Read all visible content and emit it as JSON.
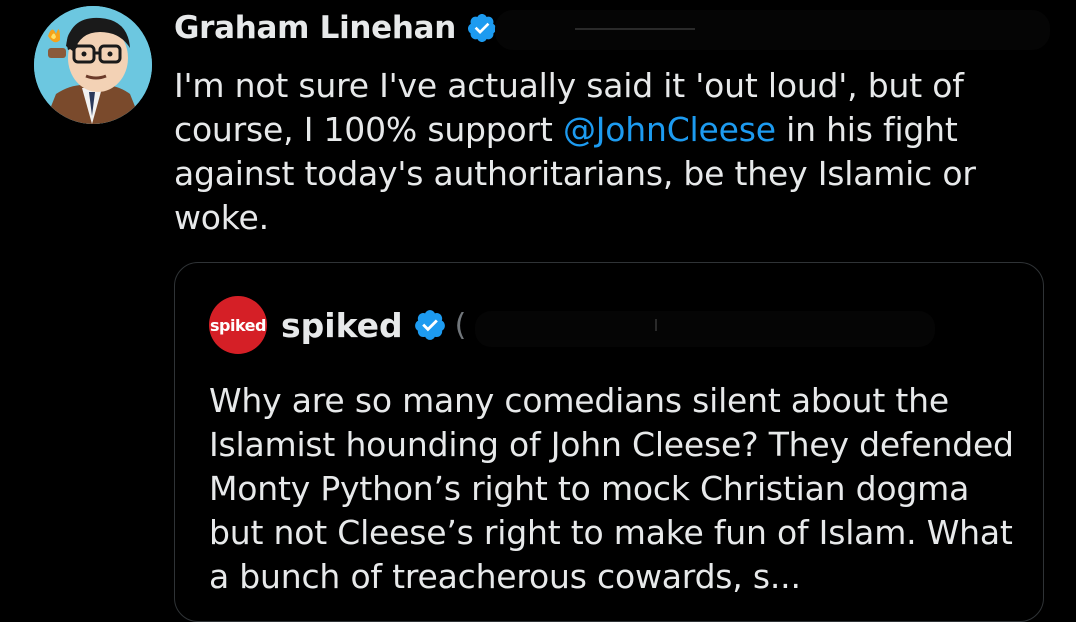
{
  "tweet": {
    "author_name": "Graham Linehan",
    "text_before": "I'm not sure I've actually said it 'out loud', but of course, I 100% support ",
    "mention": "@JohnCleese",
    "text_after": " in his fight against today's authoritarians, be they Islamic or woke."
  },
  "quote": {
    "avatar_text": "spiked",
    "author_name": "spiked",
    "handle_prefix": "(",
    "text": "Why are so many comedians silent about the Islamist hounding of John Cleese? They defended Monty Python’s right to mock Christian dogma but not Cleese’s right to make fun of Islam. What a bunch of treacherous cowards, s..."
  },
  "colors": {
    "background": "#000000",
    "text": "#e7e9ea",
    "link": "#1d9bf0",
    "verified": "#1d9bf0",
    "border": "#2f3336",
    "spiked_red": "#d51f26"
  },
  "icons": {
    "verified": "verified-badge-icon"
  }
}
